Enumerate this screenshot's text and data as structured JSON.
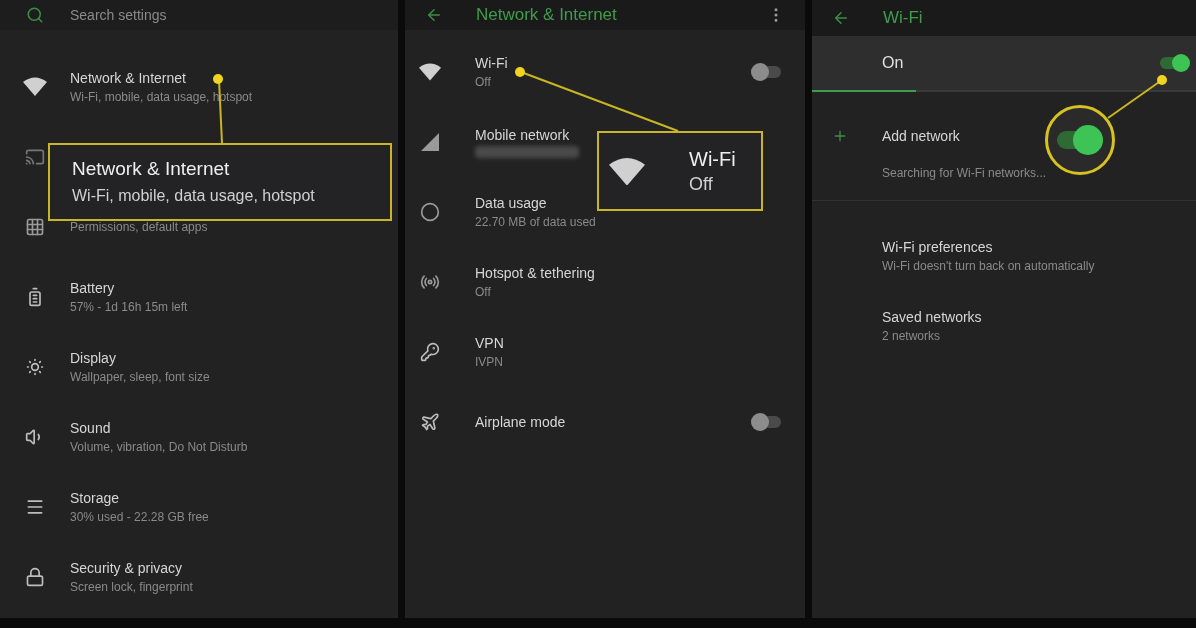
{
  "settings_panel": {
    "search": {
      "placeholder": "Search settings"
    },
    "items": [
      {
        "title": "Network & Internet",
        "subtitle": "Wi-Fi, mobile, data usage, hotspot"
      },
      {
        "kind": "covered"
      },
      {
        "subtitle": "Permissions, default apps"
      },
      {
        "title": "Battery",
        "subtitle": "57% - 1d 16h 15m left"
      },
      {
        "title": "Display",
        "subtitle": "Wallpaper, sleep, font size"
      },
      {
        "title": "Sound",
        "subtitle": "Volume, vibration, Do Not Disturb"
      },
      {
        "title": "Storage",
        "subtitle": "30% used - 22.28 GB free"
      },
      {
        "title": "Security & privacy",
        "subtitle": "Screen lock, fingerprint"
      }
    ]
  },
  "network_panel": {
    "title": "Network & Internet",
    "items": [
      {
        "title": "Wi-Fi",
        "subtitle": "Off",
        "kind": "toggle",
        "on": false
      },
      {
        "title": "Mobile network",
        "kind": "blurred"
      },
      {
        "title": "Data usage",
        "subtitle": "22.70 MB of data used",
        "kind": "plain"
      },
      {
        "title": "Hotspot & tethering",
        "subtitle": "Off",
        "kind": "plain"
      },
      {
        "title": "VPN",
        "subtitle": "IVPN",
        "kind": "plain"
      },
      {
        "title": "Airplane mode",
        "kind": "toggle",
        "on": false
      }
    ]
  },
  "wifi_panel": {
    "title": "Wi-Fi",
    "master": {
      "label": "On",
      "on": true,
      "level": 0.27
    },
    "add_network": "Add network",
    "status": "Searching for Wi-Fi networks...",
    "items": [
      {
        "title": "Wi-Fi preferences",
        "subtitle": "Wi-Fi doesn't turn back on automatically"
      },
      {
        "title": "Saved networks",
        "subtitle": "2 networks"
      }
    ]
  },
  "callouts": [
    {
      "title": "Network & Internet",
      "subtitle": "Wi-Fi, mobile, data usage, hotspot"
    },
    {
      "title": "Wi-Fi",
      "subtitle": "Off"
    },
    {
      "kind": "toggle",
      "on": true
    }
  ]
}
